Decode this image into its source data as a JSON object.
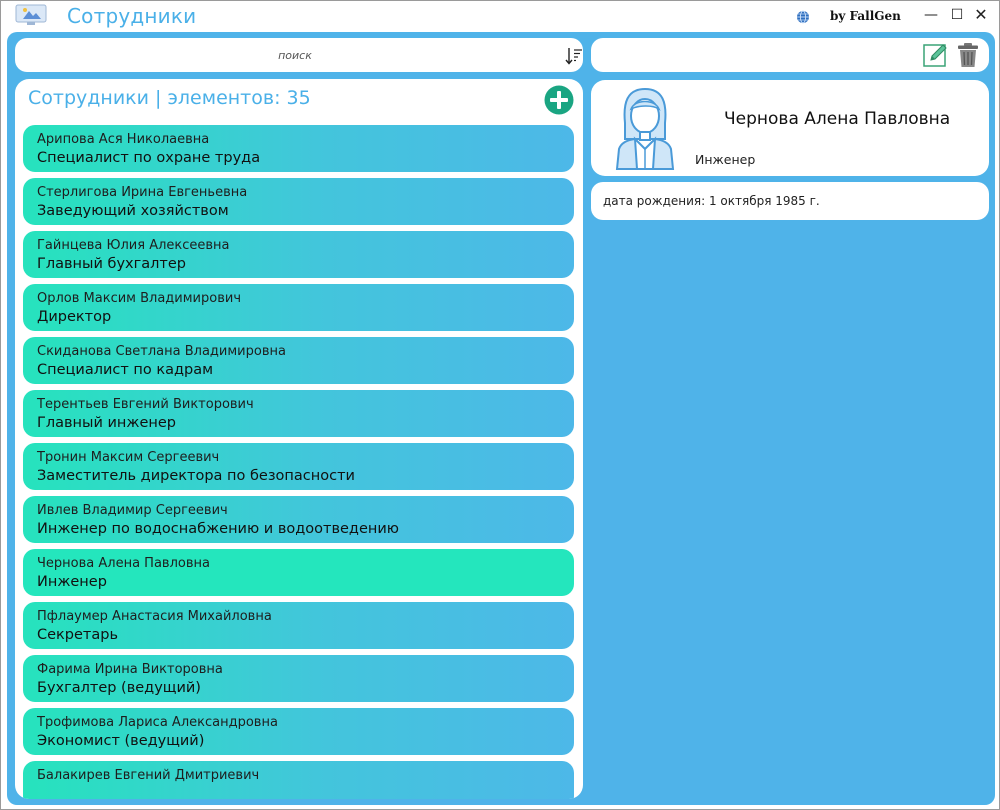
{
  "window": {
    "title": "Сотрудники",
    "by_label": "by FallGen",
    "icons": {
      "app": "app-monitor-icon",
      "globe": "globe-icon"
    },
    "controls": {
      "minimize": "—",
      "maximize": "☐",
      "close": "✕"
    }
  },
  "search": {
    "placeholder": "поиск",
    "value": ""
  },
  "list": {
    "header": "Сотрудники | элементов: 35",
    "items": [
      {
        "name": "Арипова Ася Николаевна",
        "position": "Специалист по охране труда"
      },
      {
        "name": "Стерлигова Ирина Евгеньевна",
        "position": "Заведующий хозяйством"
      },
      {
        "name": "Гайнцева Юлия Алексеевна",
        "position": "Главный бухгалтер"
      },
      {
        "name": "Орлов Максим Владимирович",
        "position": "Директор"
      },
      {
        "name": "Скиданова Светлана Владимировна",
        "position": "Специалист по кадрам"
      },
      {
        "name": "Терентьев Евгений Викторович",
        "position": "Главный инженер"
      },
      {
        "name": "Тронин Максим Сергеевич",
        "position": "Заместитель директора по безопасности"
      },
      {
        "name": "Ивлев Владимир Сергеевич",
        "position": "Инженер по водоснабжению и водоотведению"
      },
      {
        "name": "Чернова Алена Павловна",
        "position": "Инженер",
        "selected": true
      },
      {
        "name": "Пфлаумер Анастасия Михайловна",
        "position": "Секретарь"
      },
      {
        "name": "Фарима Ирина Викторовна",
        "position": "Бухгалтер (ведущий)"
      },
      {
        "name": "Трофимова Лариса Александровна",
        "position": "Экономист (ведущий)"
      },
      {
        "name": "Балакирев Евгений Дмитриевич",
        "position": ""
      }
    ]
  },
  "detail": {
    "name": "Чернова Алена Павловна",
    "position": "Инженер",
    "birth": "дата рождения: 1 октября 1985 г."
  },
  "colors": {
    "accent": "#4fb3e9",
    "title": "#4ab0e8",
    "card_start": "#26e3bd",
    "card_end": "#4db8e8",
    "selected": "#24e6bd",
    "add": "#1aa582"
  }
}
